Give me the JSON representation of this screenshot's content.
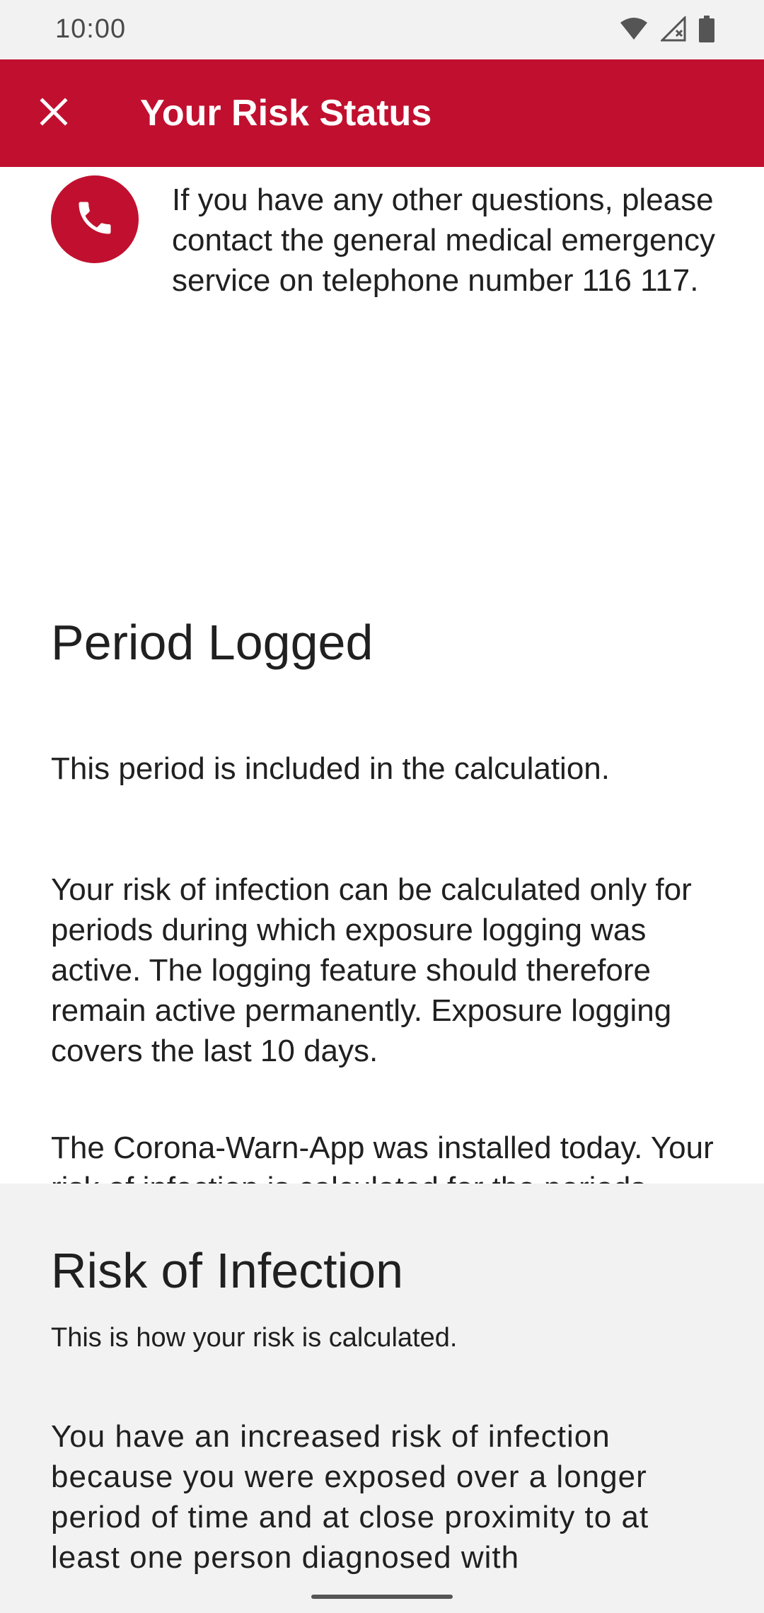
{
  "status_bar": {
    "time": "10:00",
    "icons": [
      "wifi-icon",
      "signal-icon",
      "battery-icon"
    ]
  },
  "app_bar": {
    "title": "Your Risk Status",
    "close_icon": "close-icon",
    "background": "#c1102f"
  },
  "contact": {
    "icon": "phone-icon",
    "text": "If you have any other questions, please contact the general medical emergency service on telephone number 116 117."
  },
  "period_logged": {
    "title": "Period Logged",
    "subtitle": "This period is included in the calculation.",
    "paragraph1": "Your risk of infection can be calculated only for periods during which exposure logging was active. The logging feature should therefore remain active permanently. Exposure logging covers the last 10 days.",
    "paragraph2": "The Corona-Warn-App was installed today. Your risk of infection is calculated for the periods during which exposure logging was active. If you have encountered other people and exposure logging was active, your risk of infection is calculated."
  },
  "risk_of_infection": {
    "title": "Risk of Infection",
    "subtitle": "This is how your risk is calculated.",
    "paragraph": "You have an increased risk of infection because you were exposed over a longer period of time and at close proximity to at least one person diagnosed with"
  }
}
